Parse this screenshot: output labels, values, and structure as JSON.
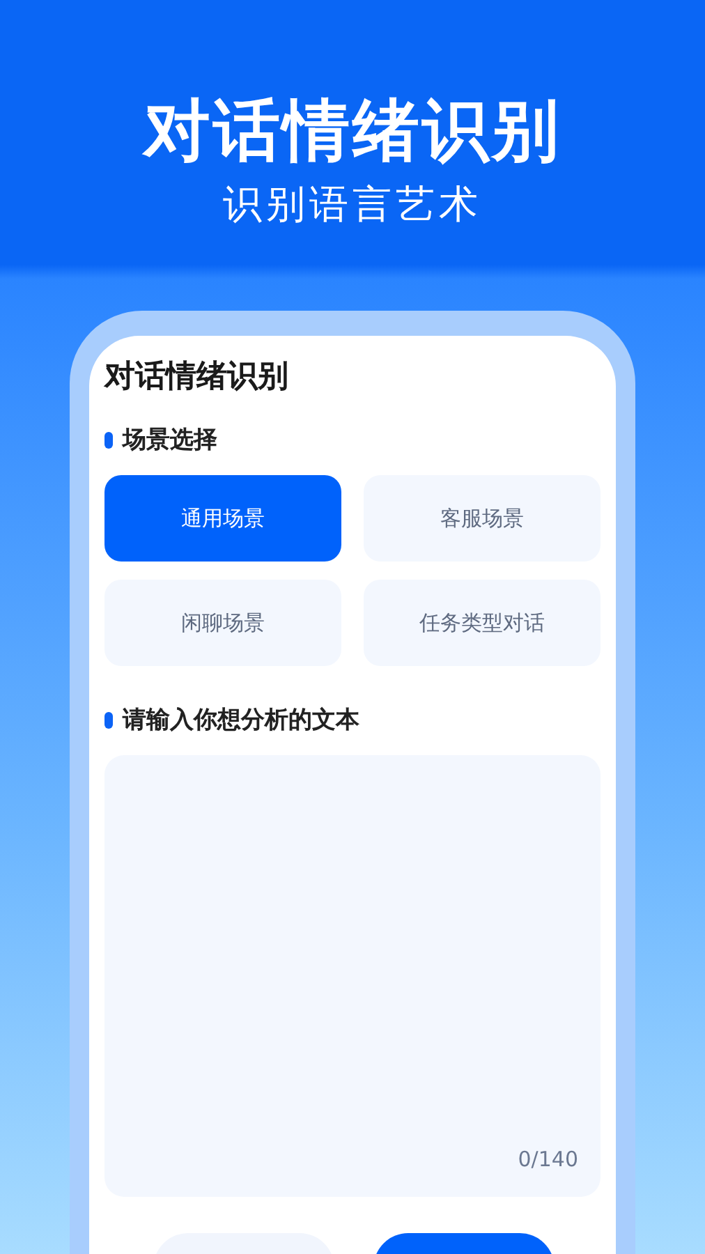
{
  "banner": {
    "title": "对话情绪识别",
    "subtitle": "识别语言艺术"
  },
  "card": {
    "title": "对话情绪识别",
    "scene_section": {
      "label": "场景选择",
      "options": [
        {
          "label": "通用场景",
          "selected": true
        },
        {
          "label": "客服场景",
          "selected": false
        },
        {
          "label": "闲聊场景",
          "selected": false
        },
        {
          "label": "任务类型对话",
          "selected": false
        }
      ]
    },
    "text_section": {
      "label": "请输入你想分析的文本",
      "counter": "0/140"
    },
    "actions": [
      {
        "kind": "secondary"
      },
      {
        "kind": "primary"
      }
    ]
  }
}
